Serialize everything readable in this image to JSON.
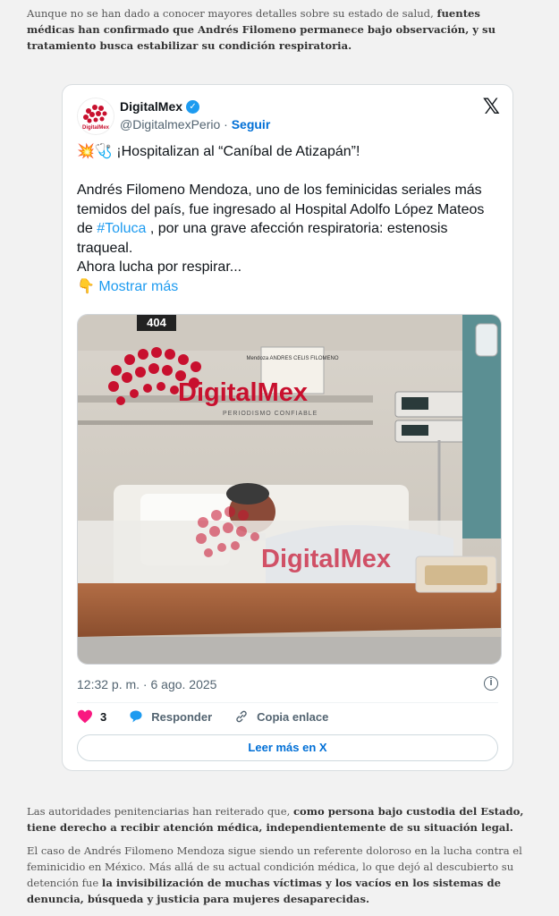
{
  "article": {
    "p1_normal": "Aunque no se han dado a conocer mayores detalles sobre su estado de salud, ",
    "p1_bold": "fuentes médicas han confirmado que Andrés Filomeno permanece bajo observación, y su tratamiento busca estabilizar su condición respiratoria.",
    "p2_normal": "Las autoridades penitenciarias han reiterado que, ",
    "p2_bold": "como persona bajo custodia del Estado, tiene derecho a recibir atención médica, independientemente de su situación legal.",
    "p3_normal": "El caso de Andrés Filomeno Mendoza sigue siendo un referente doloroso en la lucha contra el feminicidio en México. Más allá de su actual condición médica, lo que dejó al descubierto su detención fue ",
    "p3_bold": "la invisibilización de muchas víctimas y los vacíos en los sistemas de denuncia, búsqueda y justicia para mujeres desaparecidas."
  },
  "tweet": {
    "author_name": "DigitalMex",
    "handle": "@DigitalmexPerio",
    "separator": " · ",
    "follow_label": "Seguir",
    "x_logo": "𝕏",
    "line1": "💥🩺 ¡Hospitalizan al “Caníbal de Atizapán”!",
    "body_a": "Andrés Filomeno Mendoza, uno de los feminicidas seriales más temidos del país, fue ingresado al Hospital Adolfo López Mateos de ",
    "hashtag": "#Toluca",
    "body_b": " , por una grave afección respiratoria: estenosis traqueal.\nAhora lucha por respirar...",
    "more_emoji": "👇",
    "more_label": "Mostrar más",
    "photo": {
      "room_number": "404",
      "watermark": "DigitalMex",
      "watermark_sub": "PERIODISMO CONFIABLE",
      "note_text": "Mendoza ANDRES CELIS FILOMENO"
    },
    "timestamp": "12:32 p. m. · 6 ago. 2025",
    "info_icon": "i",
    "likes": "3",
    "reply_label": "Responder",
    "copy_label": "Copia enlace",
    "read_more_label": "Leer más en X",
    "colors": {
      "accent": "#1d9bf0",
      "like": "#f91880",
      "brand_red": "#c8102e"
    }
  }
}
